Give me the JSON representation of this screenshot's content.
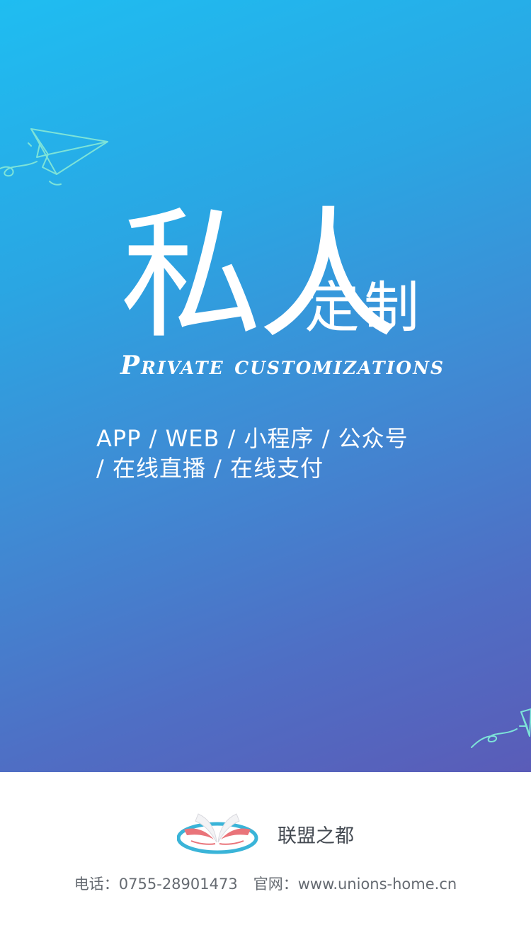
{
  "hero": {
    "title_main": "私人",
    "title_sub": "定制",
    "tagline": "Private   customizations",
    "services_line1": "APP / WEB / 小程序 / 公众号",
    "services_line2": "/ 在线直播 / 在线支付",
    "gradient_colors": [
      "#1fbdf1",
      "#3f8bd4",
      "#5a5cb8"
    ]
  },
  "footer": {
    "brand_name": "联盟之都",
    "phone_label": "电话：",
    "phone": "0755-28901473",
    "site_label": "官网：",
    "site": "www.unions-home.cn"
  },
  "icons": {
    "decor_top": "paper-plane-icon",
    "decor_bottom": "paper-plane-icon",
    "logo": "birds-logo-icon"
  }
}
